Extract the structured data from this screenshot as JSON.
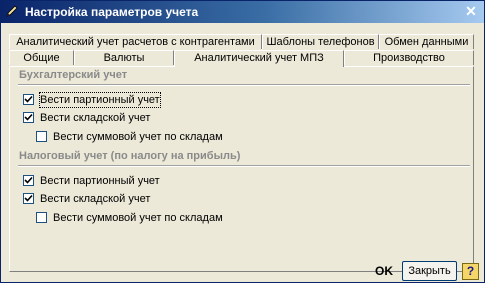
{
  "window": {
    "title": "Настройка параметров учета",
    "close_icon": "close-icon"
  },
  "tabs": {
    "row1": [
      {
        "label": "Аналитический учет расчетов с контрагентами",
        "active": false
      },
      {
        "label": "Шаблоны телефонов",
        "active": false
      },
      {
        "label": "Обмен данными",
        "active": false
      }
    ],
    "row2": [
      {
        "label": "Общие",
        "active": false
      },
      {
        "label": "Валюты",
        "active": false
      },
      {
        "label": "Аналитический учет МПЗ",
        "active": true
      },
      {
        "label": "Производство",
        "active": false
      }
    ]
  },
  "accounting": {
    "title": "Бухгалтерский учет",
    "options": [
      {
        "label": "Вести партионный учет",
        "checked": true
      },
      {
        "label": "Вести складской учет",
        "checked": true
      },
      {
        "label": "Вести суммовой учет по складам",
        "checked": false
      }
    ]
  },
  "tax": {
    "title": "Налоговый учет (по налогу на прибыль)",
    "options": [
      {
        "label": "Вести партионный учет",
        "checked": true
      },
      {
        "label": "Вести складской учет",
        "checked": true
      },
      {
        "label": "Вести суммовой учет по складам",
        "checked": false
      }
    ]
  },
  "footer": {
    "ok_label": "OK",
    "close_label": "Закрыть",
    "help_label": "?"
  }
}
